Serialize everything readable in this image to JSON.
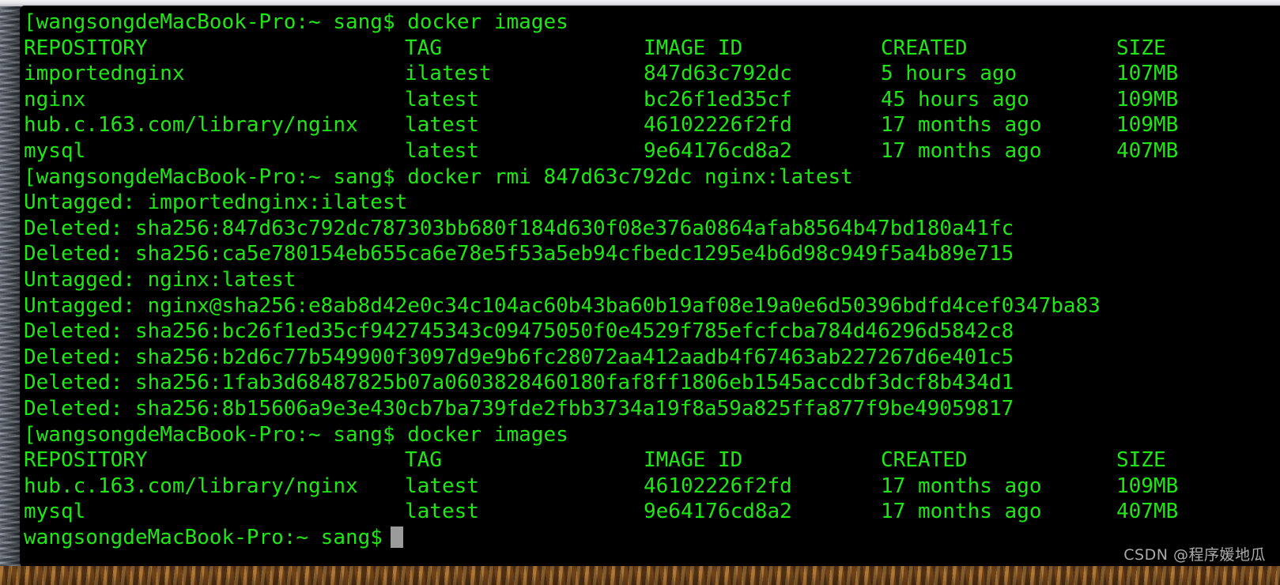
{
  "window": {
    "title": "Terminal — wangsongdeMacBook-Pro",
    "background_color": "#000000",
    "text_color": "#21e616",
    "cursor_color": "#9b9b9b"
  },
  "terminal": {
    "prompt": "wangsongdeMacBook-Pro:~ sang$",
    "lines": [
      {
        "type": "prompt",
        "bracket": "[",
        "prompt": "wangsongdeMacBook-Pro:~ sang$",
        "command": " docker images"
      },
      {
        "type": "header",
        "repository": "REPOSITORY",
        "tag": "TAG",
        "image_id": "IMAGE ID",
        "created": "CREATED",
        "size": "SIZE"
      },
      {
        "type": "row",
        "repository": "importednginx",
        "tag": "ilatest",
        "image_id": "847d63c792dc",
        "created": "5 hours ago",
        "size": "107MB"
      },
      {
        "type": "row",
        "repository": "nginx",
        "tag": "latest",
        "image_id": "bc26f1ed35cf",
        "created": "45 hours ago",
        "size": "109MB"
      },
      {
        "type": "row",
        "repository": "hub.c.163.com/library/nginx",
        "tag": "latest",
        "image_id": "46102226f2fd",
        "created": "17 months ago",
        "size": "109MB"
      },
      {
        "type": "row",
        "repository": "mysql",
        "tag": "latest",
        "image_id": "9e64176cd8a2",
        "created": "17 months ago",
        "size": "407MB"
      },
      {
        "type": "prompt",
        "bracket": "[",
        "prompt": "wangsongdeMacBook-Pro:~ sang$",
        "command": " docker rmi 847d63c792dc nginx:latest"
      },
      {
        "type": "output",
        "text": "Untagged: importednginx:ilatest"
      },
      {
        "type": "output",
        "text": "Deleted: sha256:847d63c792dc787303bb680f184d630f08e376a0864afab8564b47bd180a41fc"
      },
      {
        "type": "output",
        "text": "Deleted: sha256:ca5e780154eb655ca6e78e5f53a5eb94cfbedc1295e4b6d98c949f5a4b89e715"
      },
      {
        "type": "output",
        "text": "Untagged: nginx:latest"
      },
      {
        "type": "output",
        "text": "Untagged: nginx@sha256:e8ab8d42e0c34c104ac60b43ba60b19af08e19a0e6d50396bdfd4cef0347ba83"
      },
      {
        "type": "output",
        "text": "Deleted: sha256:bc26f1ed35cf942745343c09475050f0e4529f785efcfcba784d46296d5842c8"
      },
      {
        "type": "output",
        "text": "Deleted: sha256:b2d6c77b549900f3097d9e9b6fc28072aa412aadb4f67463ab227267d6e401c5"
      },
      {
        "type": "output",
        "text": "Deleted: sha256:1fab3d68487825b07a0603828460180faf8ff1806eb1545accdbf3dcf8b434d1"
      },
      {
        "type": "output",
        "text": "Deleted: sha256:8b15606a9e3e430cb7ba739fde2fbb3734a19f8a59a825ffa877f9be49059817"
      },
      {
        "type": "prompt",
        "bracket": "[",
        "prompt": "wangsongdeMacBook-Pro:~ sang$",
        "command": " docker images"
      },
      {
        "type": "header",
        "repository": "REPOSITORY",
        "tag": "TAG",
        "image_id": "IMAGE ID",
        "created": "CREATED",
        "size": "SIZE"
      },
      {
        "type": "row",
        "repository": "hub.c.163.com/library/nginx",
        "tag": "latest",
        "image_id": "46102226f2fd",
        "created": "17 months ago",
        "size": "109MB"
      },
      {
        "type": "row",
        "repository": "mysql",
        "tag": "latest",
        "image_id": "9e64176cd8a2",
        "created": "17 months ago",
        "size": "407MB"
      },
      {
        "type": "prompt",
        "bracket": "",
        "prompt": "wangsongdeMacBook-Pro:~ sang$",
        "command": "",
        "cursor": true
      }
    ]
  },
  "watermark": {
    "text": "CSDN @程序媛地瓜"
  }
}
